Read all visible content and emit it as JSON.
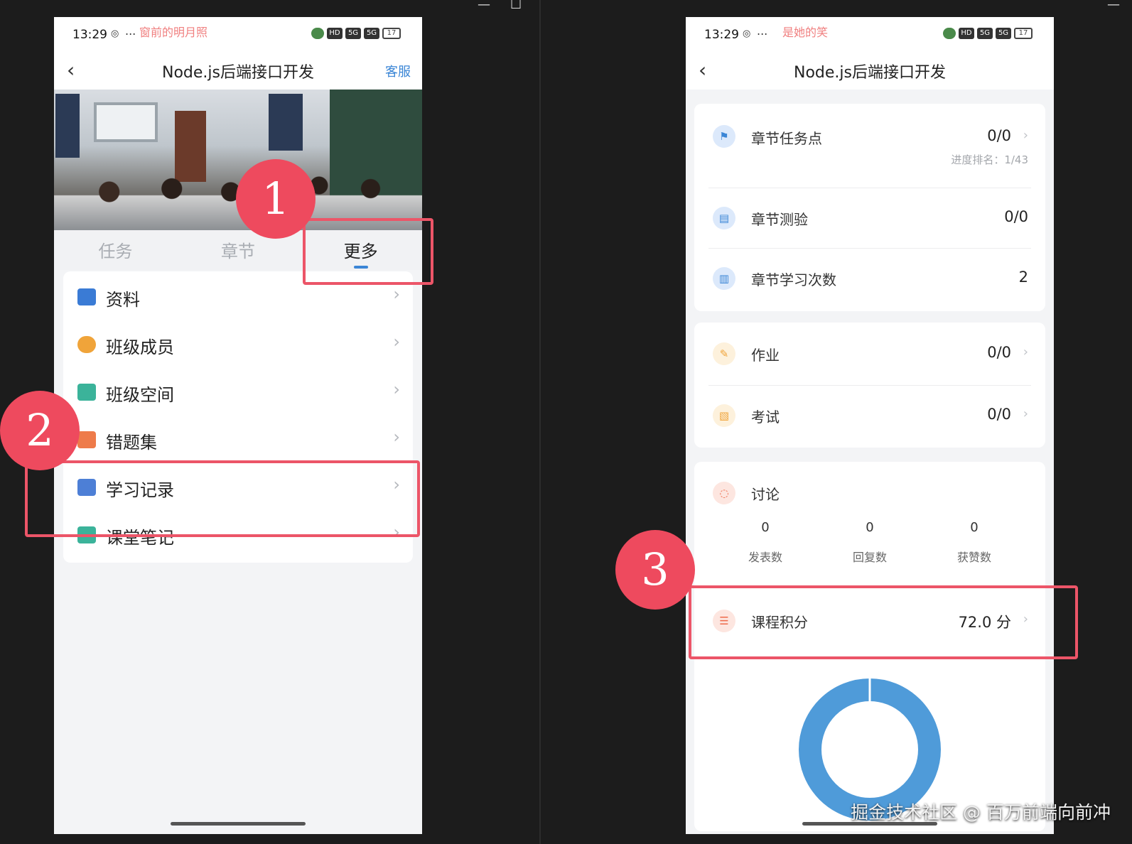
{
  "status_bar": {
    "time": "13:29",
    "left_notice": "窗前的明月照",
    "right_notice": "是她的笑",
    "more": "...",
    "hd_label": "HD",
    "signal_label": "5G",
    "battery": "17"
  },
  "left_screen": {
    "title": "Node.js后端接口开发",
    "back_icon": "‹",
    "service_label": "客服",
    "tabs": [
      {
        "label": "任务",
        "active": false
      },
      {
        "label": "章节",
        "active": false
      },
      {
        "label": "更多",
        "active": true
      }
    ],
    "menu": [
      {
        "label": "资料",
        "icon": "folder-icon",
        "color": "#3a7bd5"
      },
      {
        "label": "班级成员",
        "icon": "members-icon",
        "color": "#f0a43a"
      },
      {
        "label": "班级空间",
        "icon": "chat-icon",
        "color": "#3bb39a"
      },
      {
        "label": "错题集",
        "icon": "mistakes-icon",
        "color": "#ee7b4a"
      },
      {
        "label": "学习记录",
        "icon": "record-icon",
        "color": "#4d7fd6"
      },
      {
        "label": "课堂笔记",
        "icon": "notes-icon",
        "color": "#3bb39a"
      }
    ],
    "chevron": "›"
  },
  "right_screen": {
    "title": "Node.js后端接口开发",
    "back_icon": "‹",
    "chapter_tasks": {
      "label": "章节任务点",
      "value": "0/0",
      "rank": "进度排名：1/43"
    },
    "chapter_quiz": {
      "label": "章节测验",
      "value": "0/0"
    },
    "chapter_study": {
      "label": "章节学习次数",
      "value": "2"
    },
    "homework": {
      "label": "作业",
      "value": "0/0"
    },
    "exam": {
      "label": "考试",
      "value": "0/0"
    },
    "discussion": {
      "label": "讨论",
      "stats": [
        {
          "num": "0",
          "label": "发表数"
        },
        {
          "num": "0",
          "label": "回复数"
        },
        {
          "num": "0",
          "label": "获赞数"
        }
      ]
    },
    "course_points": {
      "label": "课程积分",
      "value": "72.0 分"
    },
    "chevron": "›"
  },
  "annotations": [
    "1",
    "2",
    "3"
  ],
  "watermark": "掘金技术社区 @ 百万前端向前冲",
  "colors": {
    "accent_blue": "#3b86d6",
    "annotation_red": "#ee4a5e",
    "donut_blue": "#4f9bd9"
  }
}
